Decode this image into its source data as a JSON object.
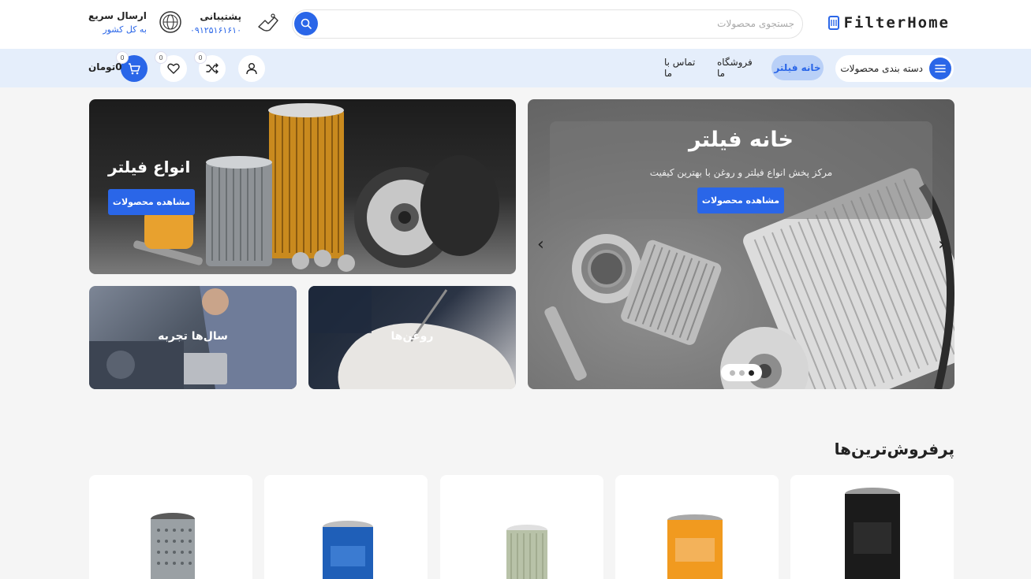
{
  "header": {
    "logo_text": "FilterHome",
    "search": {
      "placeholder": "جستجوی محصولات"
    },
    "support": {
      "title": "پشتیبانی",
      "phone": "۰۹۱۲۵۱۶۱۶۱۰"
    },
    "shipping": {
      "title": "ارسال سریع",
      "subtitle": "به کل کشور"
    }
  },
  "nav": {
    "categories_label": "دسته بندی محصولات",
    "links": [
      "خانه فیلتر",
      "فروشگاه ما",
      "تماس با ما"
    ],
    "active_link": "خانه فیلتر",
    "compare_count": "0",
    "wishlist_count": "0",
    "cart_count": "0",
    "cart_total": "0تومان"
  },
  "hero": {
    "title": "خانه فیلتر",
    "subtitle": "مرکز پخش انواع فیلتر و روغن با بهترین کیفیت",
    "button": "مشاهده محصولات",
    "slides": 3,
    "active_slide": 3
  },
  "banners": {
    "filters": {
      "title": "انواع فیلتر",
      "button": "مشاهده محصولات"
    },
    "oils": {
      "title": "روغن‌ها"
    },
    "experience": {
      "title": "سال‌ها تجربه"
    }
  },
  "best_sellers": {
    "title": "پرفروش‌ترین‌ها"
  },
  "colors": {
    "accent": "#2a66e8",
    "nav_bg": "#e5eefb",
    "page_bg": "#f5f5f5"
  }
}
